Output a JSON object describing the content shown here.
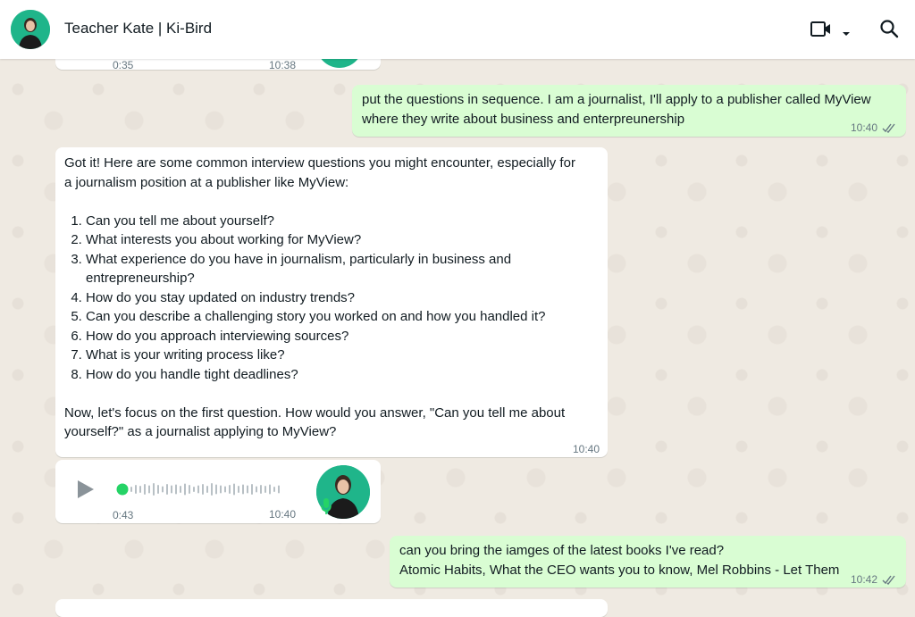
{
  "header": {
    "title": "Teacher Kate | Ki-Bird",
    "icons": [
      "video-call-icon",
      "dropdown-arrow-icon",
      "search-icon"
    ]
  },
  "top_voice": {
    "duration": "0:35",
    "time": "10:38"
  },
  "msg1": {
    "line1": "put the questions in sequence. I am a journalist, I'll apply to a publisher called MyView",
    "line2": "where they write about business and enterpreunership",
    "time": "10:40"
  },
  "msg2": {
    "intro1": "Got it! Here are some common interview questions you might encounter, especially for",
    "intro2": "a journalism position at a publisher like MyView:",
    "questions": [
      "Can you tell me about yourself?",
      "What interests you about working for MyView?",
      "What experience do you have in journalism, particularly in business and entrepreneurship?",
      "How do you stay updated on industry trends?",
      "Can you describe a challenging story you worked on and how you handled it?",
      "How do you approach interviewing sources?",
      "What is your writing process like?",
      "How do you handle tight deadlines?"
    ],
    "outro1": "Now, let's focus on the first question. How would you answer, \"Can you tell me about",
    "outro2": "yourself?\" as a journalist applying to MyView?",
    "time": "10:40"
  },
  "voice": {
    "duration": "0:43",
    "time": "10:40",
    "progress": 0
  },
  "msg3": {
    "line1": "can you bring the iamges of the latest books I've read?",
    "line2": "Atomic Habits, What the CEO wants you to know, Mel Robbins - Let Them",
    "time": "10:42"
  },
  "colors": {
    "outgoing_bubble": "#d9fdd3",
    "incoming_bubble": "#ffffff",
    "accent": "#25d366",
    "read_ticks": "#667781"
  }
}
